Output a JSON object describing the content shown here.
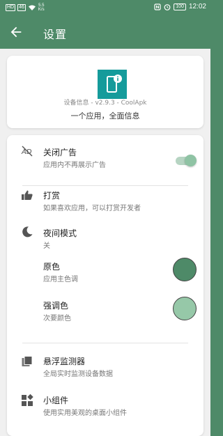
{
  "status_bar": {
    "signal_1": "HD",
    "signal_2": "46",
    "speed_value": "5.5",
    "speed_unit": "K/s",
    "battery": "100",
    "time": "12:02"
  },
  "app_bar": {
    "title": "设置"
  },
  "info_card": {
    "device_line": "设备信息 - v2.9.3 - CoolApk",
    "slogan": "一个应用，全面信息"
  },
  "settings": {
    "close_ads": {
      "title": "关闭广告",
      "subtitle": "应用内不再展示广告",
      "enabled": true
    },
    "reward": {
      "title": "打赏",
      "subtitle": "如果喜欢应用，可以打赏开发者"
    },
    "night_mode": {
      "title": "夜间模式",
      "subtitle": "关"
    },
    "primary_color": {
      "title": "原色",
      "subtitle": "应用主色调",
      "color": "#4e8a68"
    },
    "accent_color": {
      "title": "强调色",
      "subtitle": "次要颜色",
      "color": "#96c8a8"
    },
    "float_monitor": {
      "title": "悬浮监测器",
      "subtitle": "全局实时监测设备数据"
    },
    "widget": {
      "title": "小组件",
      "subtitle": "使用实用美观的桌面小组件"
    }
  },
  "colors": {
    "bar": "#4e8a68",
    "background": "#f0f0f0",
    "app_icon": "#159b9b"
  }
}
